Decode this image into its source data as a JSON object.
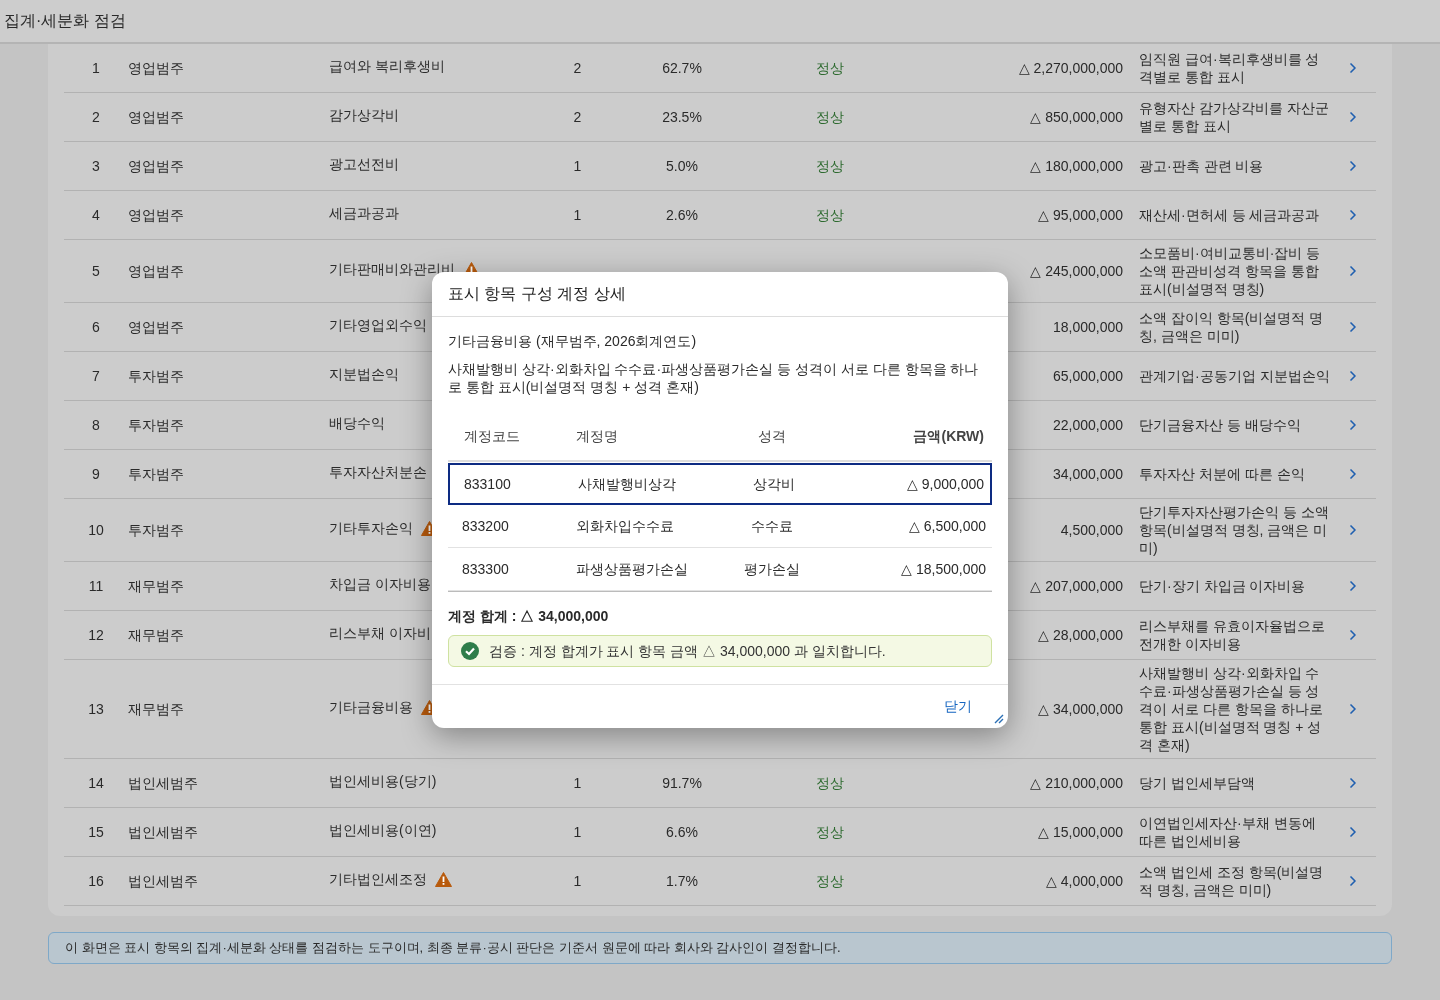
{
  "header": {
    "title": "집계·세분화 점검"
  },
  "rows": [
    {
      "no": "1",
      "category": "영업범주",
      "item": "급여와 복리후생비",
      "warning": false,
      "count": "2",
      "share": "62.7%",
      "status": {
        "label": "정상",
        "kind": "ok"
      },
      "amount": "△ 2,270,000,000",
      "description": "임직원 급여·복리후생비를 성격별로 통합 표시"
    },
    {
      "no": "2",
      "category": "영업범주",
      "item": "감가상각비",
      "warning": false,
      "count": "2",
      "share": "23.5%",
      "status": {
        "label": "정상",
        "kind": "ok"
      },
      "amount": "△ 850,000,000",
      "description": "유형자산 감가상각비를 자산군별로 통합 표시"
    },
    {
      "no": "3",
      "category": "영업범주",
      "item": "광고선전비",
      "warning": false,
      "count": "1",
      "share": "5.0%",
      "status": {
        "label": "정상",
        "kind": "ok"
      },
      "amount": "△ 180,000,000",
      "description": "광고·판촉 관련 비용"
    },
    {
      "no": "4",
      "category": "영업범주",
      "item": "세금과공과",
      "warning": false,
      "count": "1",
      "share": "2.6%",
      "status": {
        "label": "정상",
        "kind": "ok"
      },
      "amount": "△ 95,000,000",
      "description": "재산세·면허세 등 세금과공과"
    },
    {
      "no": "5",
      "category": "영업범주",
      "item": "기타판매비와관리비",
      "warning": true,
      "amount": "△ 245,000,000",
      "description": "소모품비·여비교통비·잡비 등 소액 판관비성격 항목을 통합 표시(비설명적 명칭)"
    },
    {
      "no": "6",
      "category": "영업범주",
      "item": "기타영업외수익",
      "warning": false,
      "amount": "18,000,000",
      "description": "소액 잡이익 항목(비설명적 명칭, 금액은 미미)"
    },
    {
      "no": "7",
      "category": "투자범주",
      "item": "지분법손익",
      "warning": false,
      "amount": "65,000,000",
      "description": "관계기업·공동기업 지분법손익"
    },
    {
      "no": "8",
      "category": "투자범주",
      "item": "배당수익",
      "warning": false,
      "amount": "22,000,000",
      "description": "단기금융자산 등 배당수익"
    },
    {
      "no": "9",
      "category": "투자범주",
      "item": "투자자산처분손",
      "warning": false,
      "amount": "34,000,000",
      "description": "투자자산 처분에 따른 손익"
    },
    {
      "no": "10",
      "category": "투자범주",
      "item": "기타투자손익",
      "warning": true,
      "amount": "4,500,000",
      "description": "단기투자자산평가손익 등 소액 항목(비설명적 명칭, 금액은 미미)"
    },
    {
      "no": "11",
      "category": "재무범주",
      "item": "차입금 이자비용",
      "warning": false,
      "amount": "△ 207,000,000",
      "description": "단기·장기 차입금 이자비용"
    },
    {
      "no": "12",
      "category": "재무범주",
      "item": "리스부채 이자비",
      "warning": false,
      "amount": "△ 28,000,000",
      "description": "리스부채를 유효이자율법으로 전개한 이자비용"
    },
    {
      "no": "13",
      "category": "재무범주",
      "item": "기타금융비용",
      "warning": true,
      "amount": "△ 34,000,000",
      "description": "사채발행비 상각·외화차입 수수료·파생상품평가손실 등 성격이 서로 다른 항목을 하나로 통합 표시(비설명적 명칭 + 성격 혼재)"
    },
    {
      "no": "14",
      "category": "법인세범주",
      "item": "법인세비용(당기)",
      "warning": false,
      "count": "1",
      "share": "91.7%",
      "status": {
        "label": "정상",
        "kind": "ok"
      },
      "amount": "△ 210,000,000",
      "description": "당기 법인세부담액"
    },
    {
      "no": "15",
      "category": "법인세범주",
      "item": "법인세비용(이연)",
      "warning": false,
      "count": "1",
      "share": "6.6%",
      "status": {
        "label": "정상",
        "kind": "ok"
      },
      "amount": "△ 15,000,000",
      "description": "이연법인세자산·부채 변동에 따른 법인세비용"
    },
    {
      "no": "16",
      "category": "법인세범주",
      "item": "기타법인세조정",
      "warning": true,
      "count": "1",
      "share": "1.7%",
      "status": {
        "label": "정상",
        "kind": "ok"
      },
      "amount": "△ 4,000,000",
      "description": "소액 법인세 조정 항목(비설명적 명칭, 금액은 미미)"
    }
  ],
  "notice": "이 화면은 표시 항목의 집계·세분화 상태를 점검하는 도구이며, 최종 분류·공시 판단은 기준서 원문에 따라 회사와 감사인이 결정합니다.",
  "dialog": {
    "title": "표시 항목 구성 계정 상세",
    "subtitle": "기타금융비용 (재무범주, 2026회계연도)",
    "description": "사채발행비 상각·외화차입 수수료·파생상품평가손실 등 성격이 서로 다른 항목을 하나로 통합 표시(비설명적 명칭 + 성격 혼재)",
    "columns": [
      "계정코드",
      "계정명",
      "성격",
      "금액(KRW)"
    ],
    "rows": [
      {
        "code": "833100",
        "name": "사채발행비상각",
        "type": "상각비",
        "amount": "△ 9,000,000",
        "selected": true
      },
      {
        "code": "833200",
        "name": "외화차입수수료",
        "type": "수수료",
        "amount": "△ 6,500,000",
        "selected": false
      },
      {
        "code": "833300",
        "name": "파생상품평가손실",
        "type": "평가손실",
        "amount": "△ 18,500,000",
        "selected": false
      }
    ],
    "total": "계정 합계 : △ 34,000,000",
    "check": {
      "kind": "ok",
      "text": "검증 : 계정 합계가 표시 항목 금액 △ 34,000,000 과 일치합니다."
    },
    "close_button": "닫기"
  }
}
